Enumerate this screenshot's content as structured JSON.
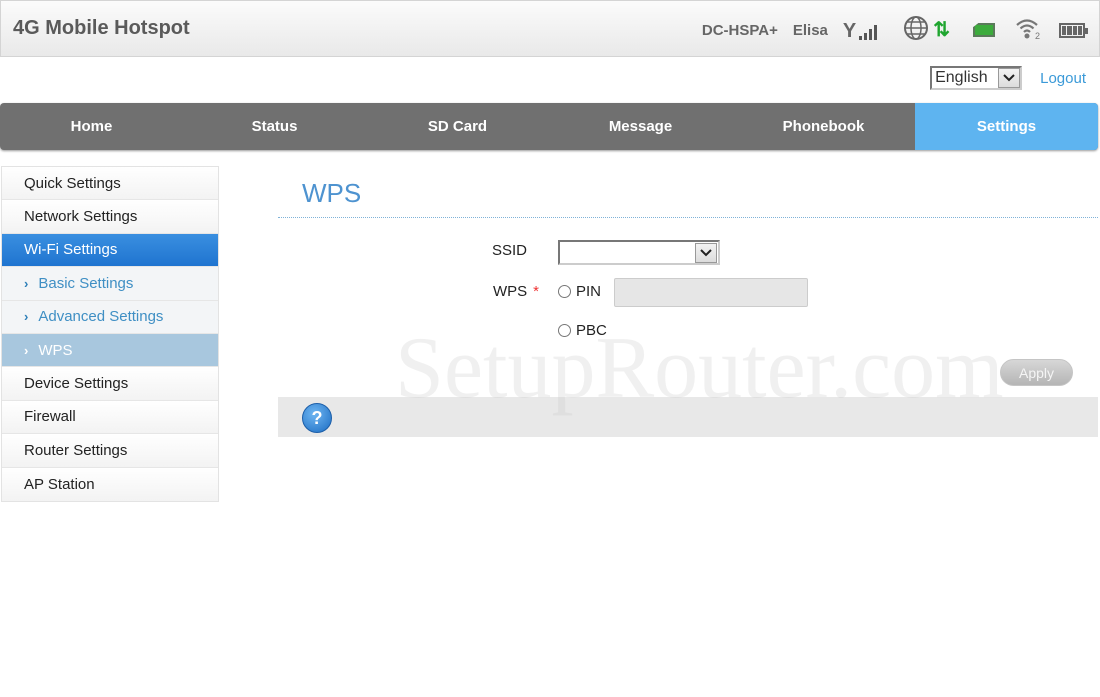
{
  "header": {
    "title": "4G Mobile Hotspot",
    "network_type": "DC-HSPA+",
    "operator": "Elisa",
    "icons": [
      "signal-strength-icon",
      "globe-icon",
      "data-transfer-icon",
      "sim-card-icon",
      "wifi-icon",
      "battery-icon"
    ],
    "wifi_clients": "2",
    "signal_bars": 4,
    "battery_level": 1.0,
    "updown_glyph": "⇅",
    "colors": {
      "data_active": "#1fa52f",
      "sim": "#3cab3c"
    }
  },
  "language": {
    "selected": "English",
    "dropdown_glyph": "⌄"
  },
  "logout_label": "Logout",
  "nav": {
    "tabs": [
      {
        "label": "Home"
      },
      {
        "label": "Status"
      },
      {
        "label": "SD Card"
      },
      {
        "label": "Message"
      },
      {
        "label": "Phonebook"
      },
      {
        "label": "Settings",
        "active": true
      }
    ],
    "colors": {
      "bar": "#707070",
      "active": "#5eb4f0"
    }
  },
  "sidebar": {
    "items": [
      {
        "label": "Quick Settings"
      },
      {
        "label": "Network Settings"
      },
      {
        "label": "Wi-Fi Settings",
        "active": true
      },
      {
        "label": "Basic Settings",
        "sub": true
      },
      {
        "label": "Advanced Settings",
        "sub": true
      },
      {
        "label": "WPS",
        "sub": true,
        "selected": true
      },
      {
        "label": "Device Settings"
      },
      {
        "label": "Firewall"
      },
      {
        "label": "Router Settings"
      },
      {
        "label": "AP Station"
      }
    ],
    "chevron_glyph": "›"
  },
  "main": {
    "page_title": "WPS",
    "ssid_label": "SSID",
    "ssid_value": "",
    "wps_label": "WPS",
    "required_mark": "*",
    "pin_label": "PIN",
    "pin_value": "",
    "pbc_label": "PBC",
    "apply_label": "Apply",
    "help_glyph": "?"
  },
  "watermark": "SetupRouter.com"
}
